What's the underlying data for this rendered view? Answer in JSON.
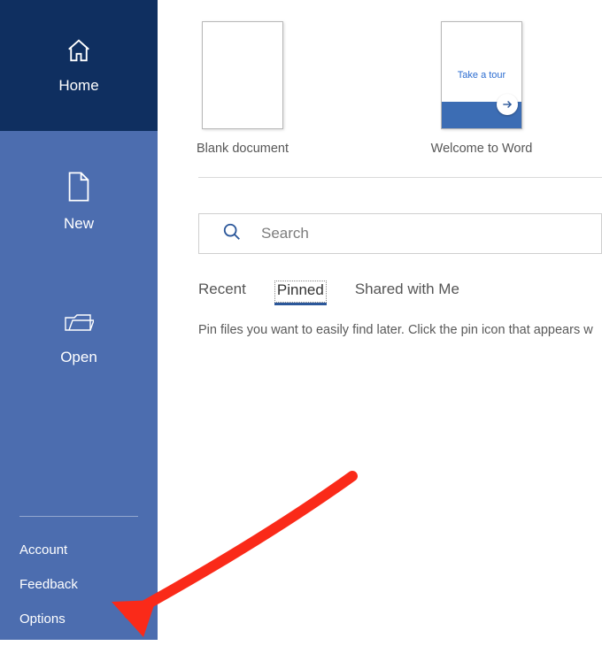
{
  "sidebar": {
    "home": {
      "label": "Home"
    },
    "new": {
      "label": "New"
    },
    "open": {
      "label": "Open"
    },
    "bottom": {
      "account": "Account",
      "feedback": "Feedback",
      "options": "Options"
    }
  },
  "templates": {
    "blank": {
      "caption": "Blank document"
    },
    "welcome": {
      "caption": "Welcome to Word",
      "tour_text": "Take a tour"
    }
  },
  "search": {
    "placeholder": "Search"
  },
  "tabs": {
    "recent": "Recent",
    "pinned": "Pinned",
    "shared": "Shared with Me"
  },
  "helper_text": "Pin files you want to easily find later. Click the pin icon that appears w",
  "colors": {
    "sidebar_top": "#0f2f60",
    "sidebar": "#4c6daf",
    "accent": "#2b579a",
    "arrow": "#fa2a19"
  }
}
